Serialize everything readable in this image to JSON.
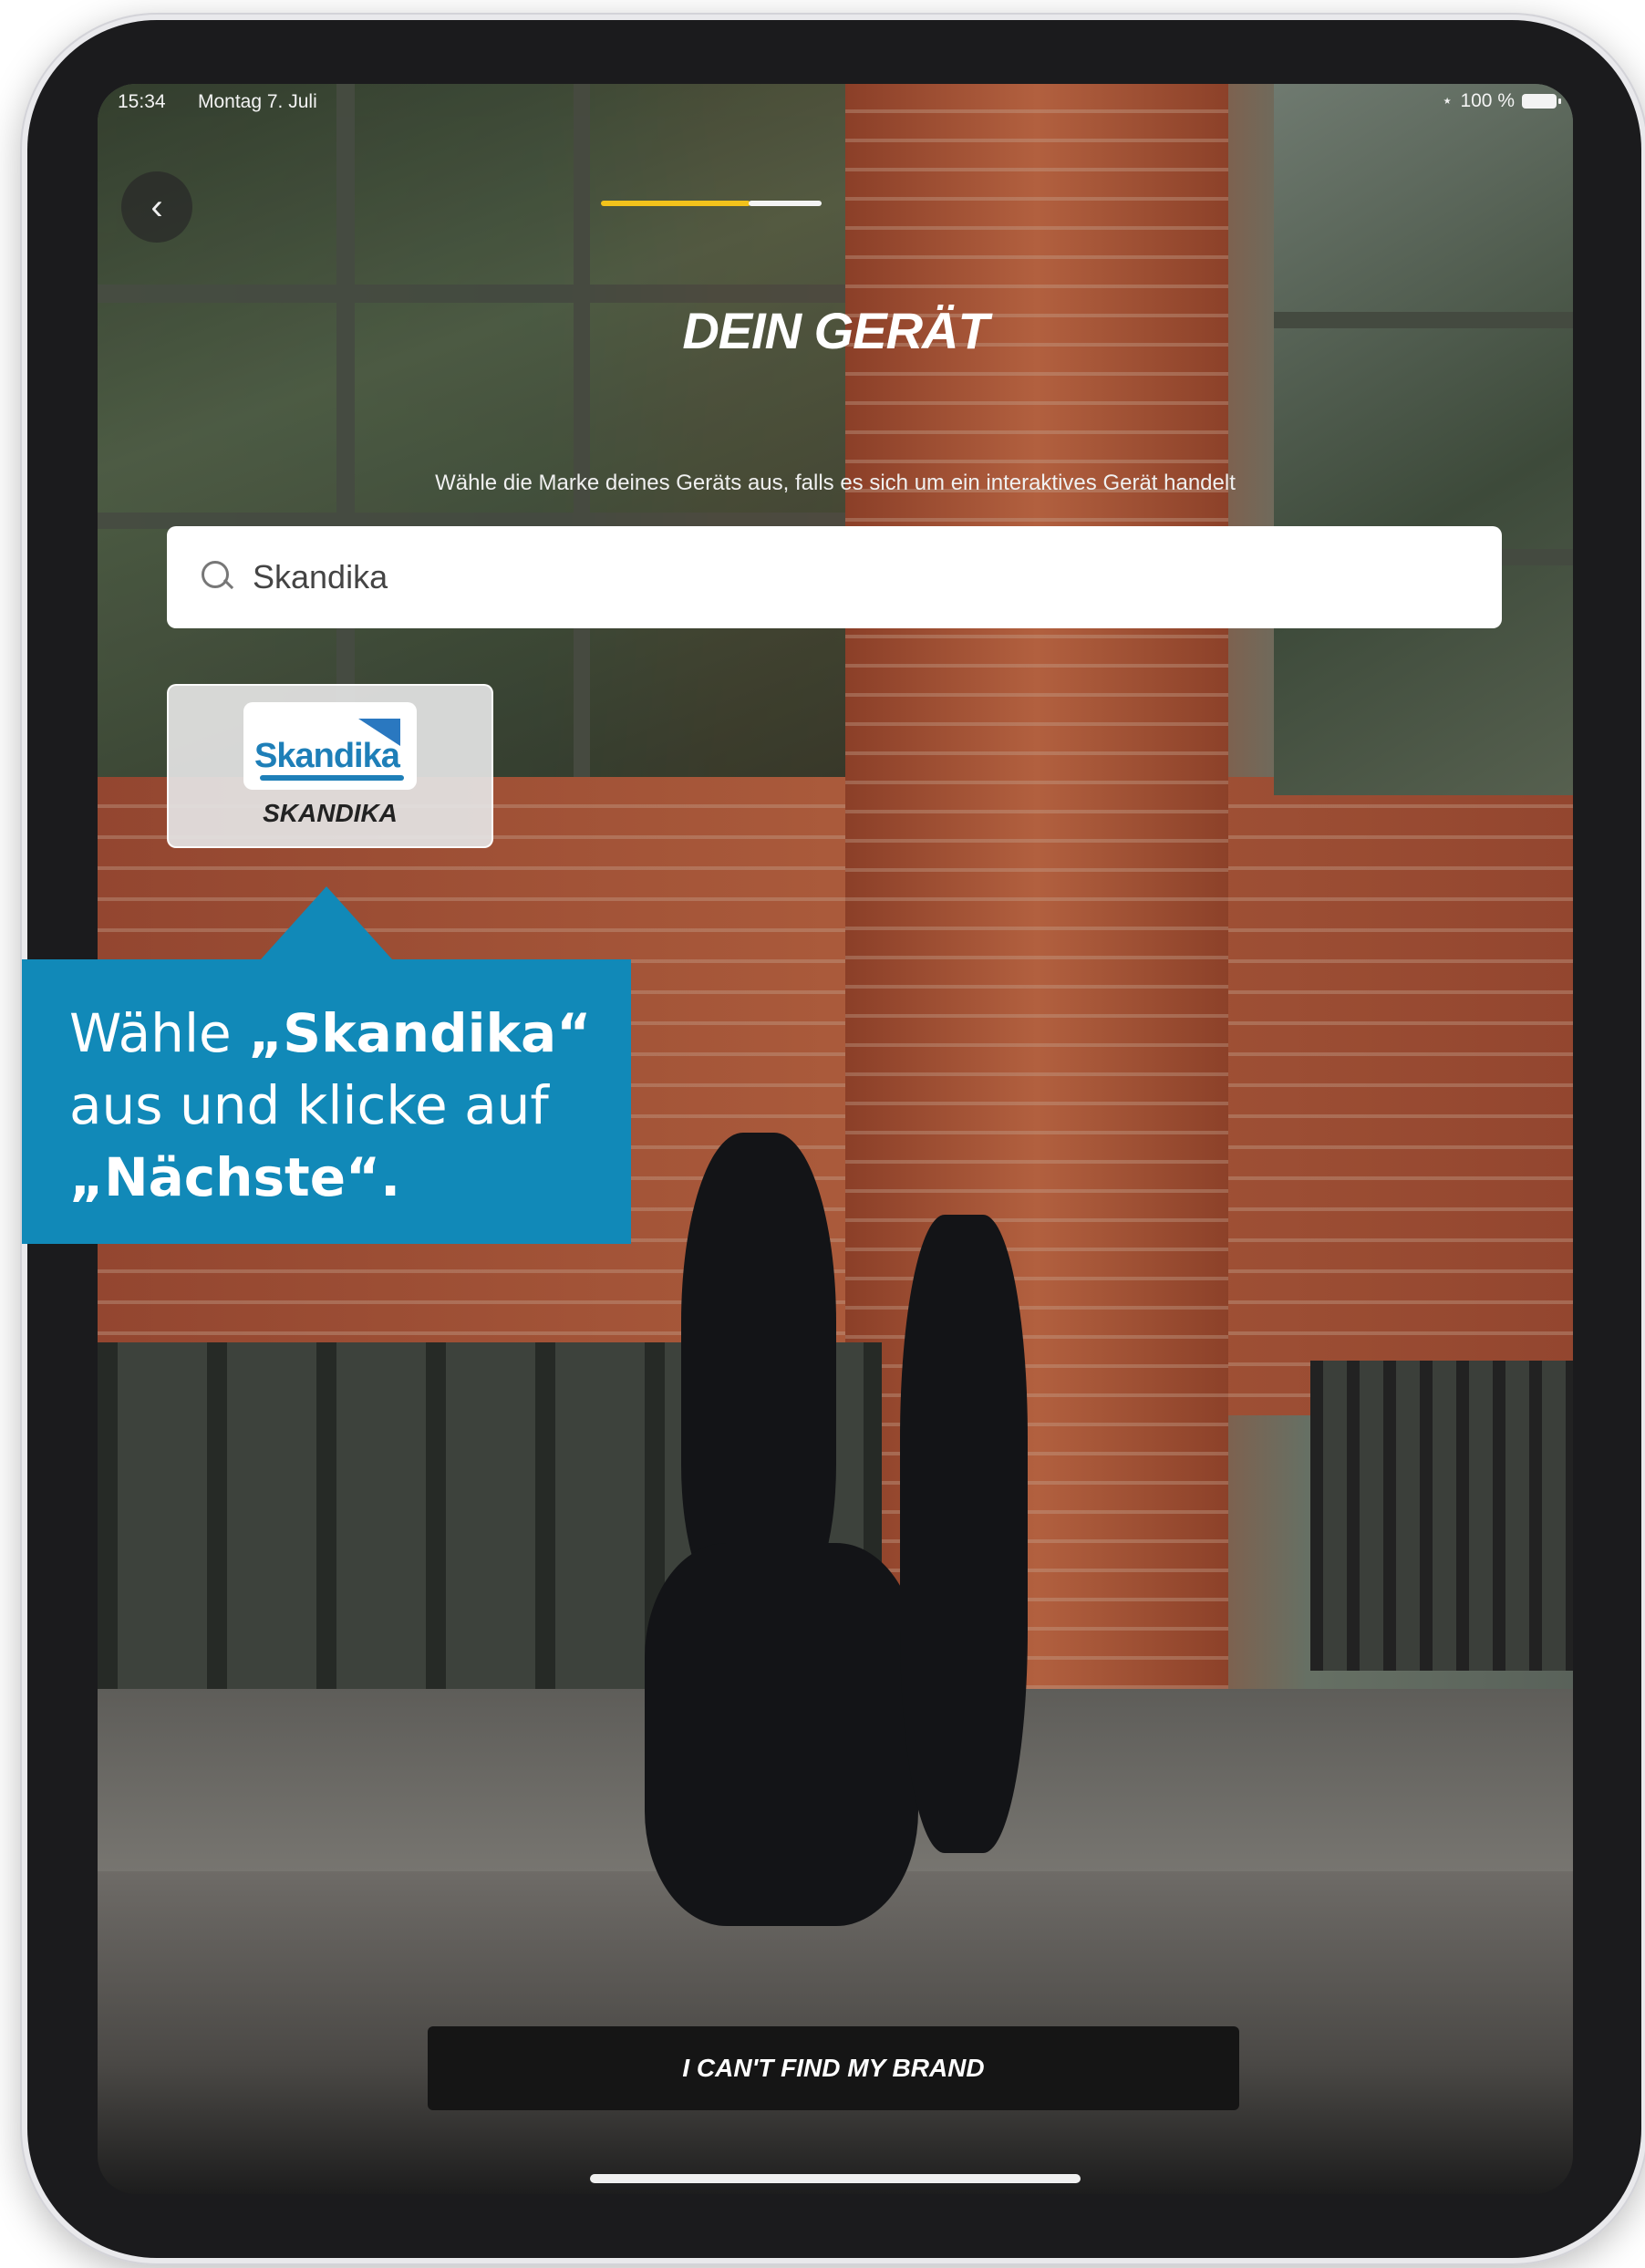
{
  "status_bar": {
    "time": "15:34",
    "date": "Montag 7. Juli",
    "battery": "100 %"
  },
  "onboarding": {
    "title": "DEIN GERÄT",
    "subtitle": "Wähle die Marke deines Geräts aus, falls es sich um ein interaktives Gerät handelt",
    "search": {
      "value": "Skandika"
    },
    "brand": {
      "logo_text": "Skandika",
      "name": "SKANDIKA"
    },
    "cta_label": "I CAN'T FIND MY BRAND",
    "accent_color": "#f2c21b"
  },
  "callout": {
    "line1_prefix": "Wähle ",
    "line1_bold": "„Skandika“",
    "line2": "aus und klicke auf",
    "line3_bold": "„Nächste“.",
    "color": "#1189b8"
  }
}
